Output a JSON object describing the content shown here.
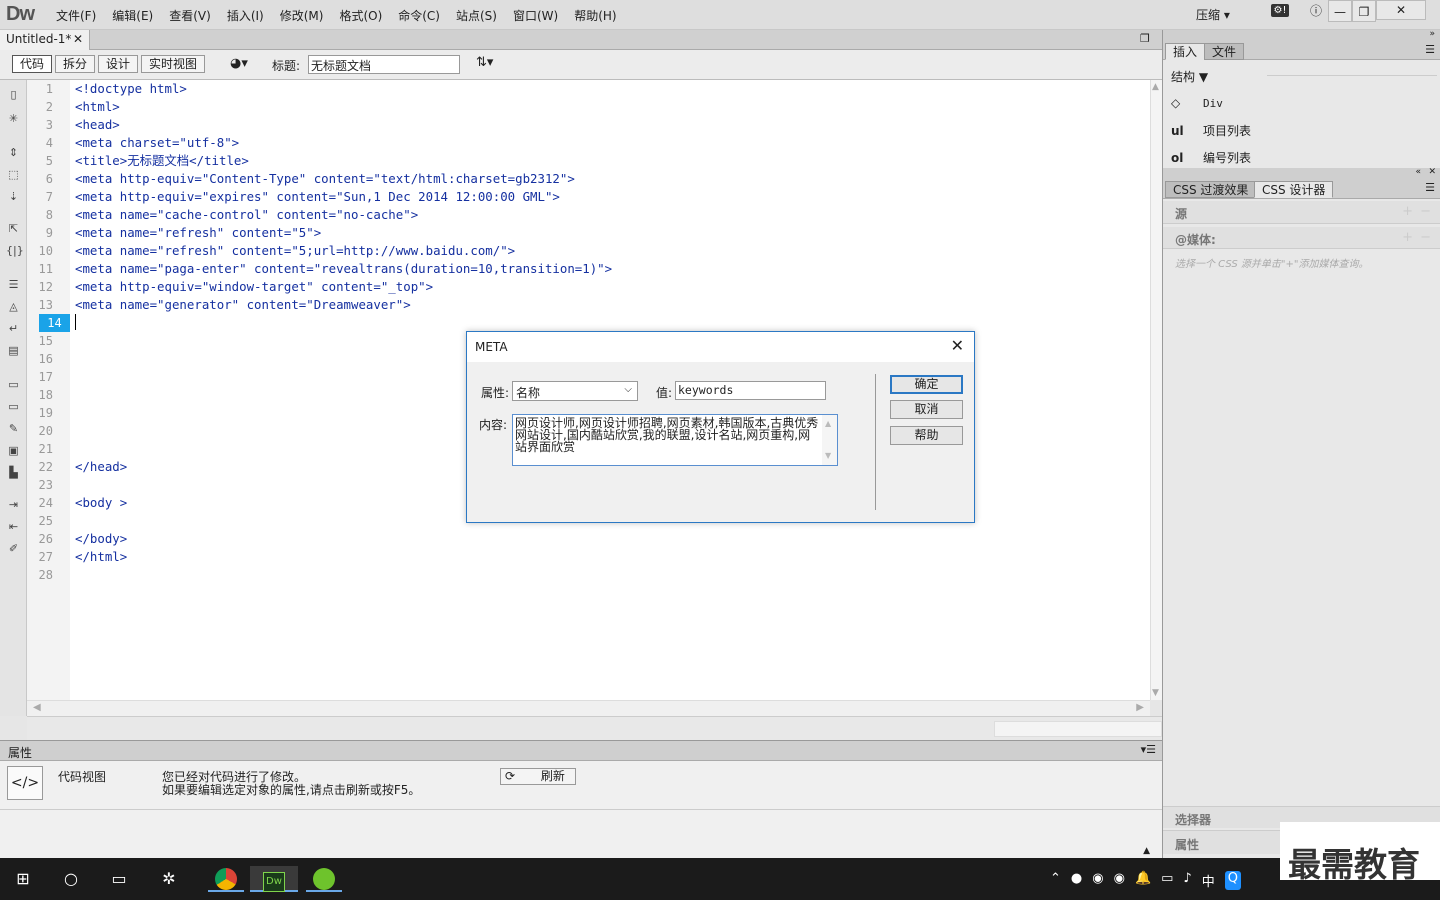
{
  "app": {
    "logo": "Dw"
  },
  "menu": [
    "文件(F)",
    "编辑(E)",
    "查看(V)",
    "插入(I)",
    "修改(M)",
    "格式(O)",
    "命令(C)",
    "站点(S)",
    "窗口(W)",
    "帮助(H)"
  ],
  "topright": {
    "compress": "压缩 ▾"
  },
  "document_tab": {
    "name": "Untitled-1*"
  },
  "toolbar": {
    "views": [
      "代码",
      "拆分",
      "设计",
      "实时视图"
    ],
    "title_label": "标题:",
    "title_value": "无标题文档"
  },
  "code": {
    "lines": [
      "<!doctype html>",
      "<html>",
      "<head>",
      "<meta charset=\"utf-8\">",
      "<title>无标题文档</title>",
      "<meta http-equiv=\"Content-Type\" content=\"text/html:charset=gb2312\">",
      "<meta http-equiv=\"expires\" content=\"Sun,1 Dec 2014 12:00:00 GML\">",
      "<meta name=\"cache-control\" content=\"no-cache\">",
      "<meta name=\"refresh\" content=\"5\">",
      "<meta name=\"refresh\" content=\"5;url=http://www.baidu.com/\">",
      "<meta name=\"paga-enter\" content=\"revealtrans(duration=10,transition=1)\">",
      "<meta http-equiv=\"window-target\" content=\"_top\">",
      "<meta name=\"generator\" content=\"Dreamweaver\">",
      "",
      "",
      "",
      "",
      "",
      "",
      "",
      "",
      "</head>",
      "",
      "<body >",
      "",
      "</body>",
      "</html>",
      ""
    ],
    "current_line": 14
  },
  "properties": {
    "header": "属性",
    "code_view_label": "代码视图",
    "message_line1": "您已经对代码进行了修改。",
    "message_line2": "如果要编辑选定对象的属性,请点击刷新或按F5。",
    "refresh_label": "刷新"
  },
  "right_panel": {
    "tabs1": [
      "插入",
      "文件"
    ],
    "structure_label": "结构 ▼",
    "insert_items": [
      {
        "icon": "◇",
        "label": "Div"
      },
      {
        "icon": "ul",
        "label": "项目列表"
      },
      {
        "icon": "ol",
        "label": "编号列表"
      }
    ],
    "tabs2": [
      "CSS 过渡效果",
      "CSS 设计器"
    ],
    "source_label": "源",
    "media_label": "@媒体:",
    "hint": "选择一个 CSS 源并单击\"+\"添加媒体查询。",
    "selector_label": "选择器",
    "property_label": "属性"
  },
  "dialog": {
    "title": "META",
    "attr_label": "属性:",
    "attr_value": "名称",
    "value_label": "值:",
    "value_value": "keywords",
    "content_label": "内容:",
    "content_value": "网页设计师,网页设计师招聘,网页素材,韩国版本,古典优秀网站设计,国内酷站欣赏,我的联盟,设计名站,网页重构,网站界面欣赏",
    "buttons": {
      "ok": "确定",
      "cancel": "取消",
      "help": "帮助"
    }
  },
  "taskbar": {
    "ime": "中"
  },
  "watermark": "最需教育"
}
